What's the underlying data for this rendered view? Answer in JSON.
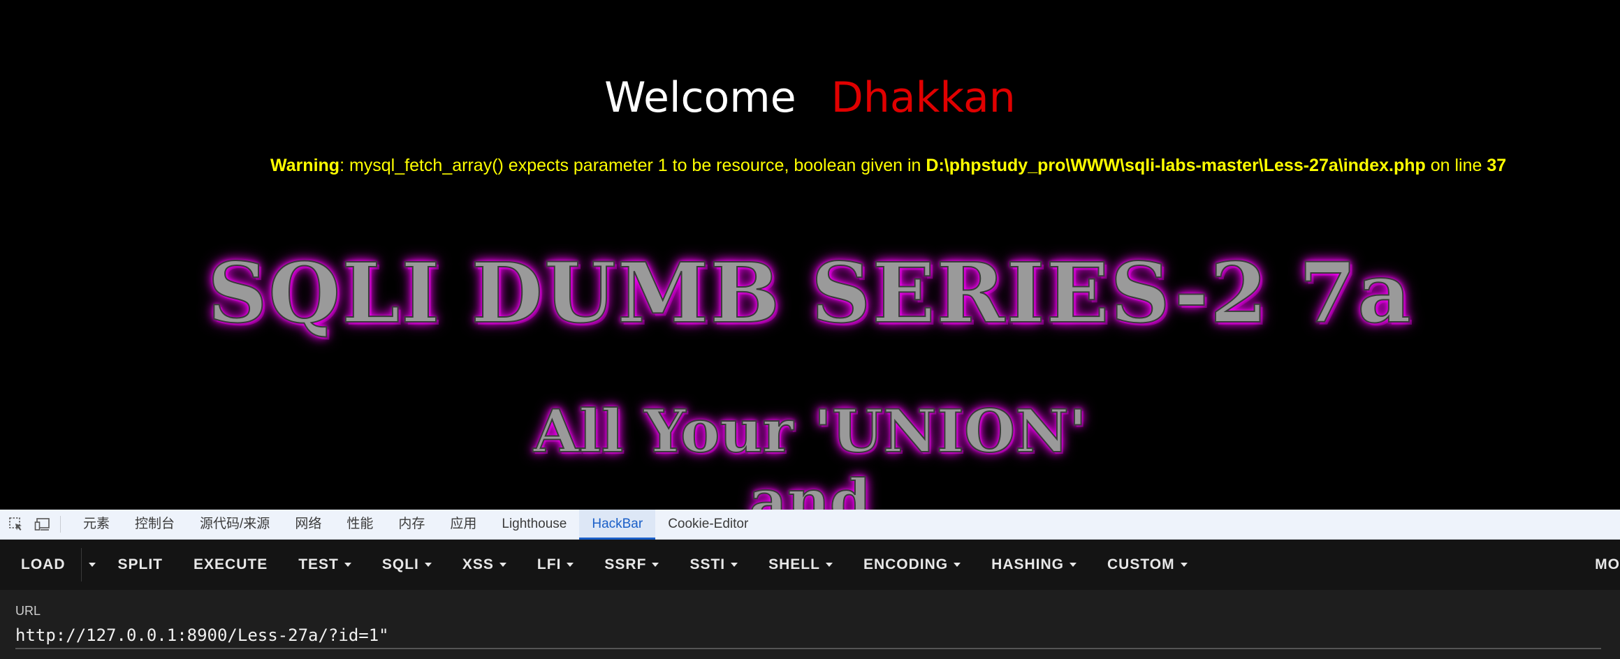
{
  "page": {
    "welcome": "Welcome",
    "name": "Dhakkan",
    "warning": {
      "label": "Warning",
      "message": ": mysql_fetch_array() expects parameter 1 to be resource, boolean given in ",
      "file": "D:\\phpstudy_pro\\WWW\\sqli-labs-master\\Less-27a\\index.php",
      "line_text": " on line ",
      "line": "37"
    },
    "banner_main": "SQLI DUMB SERIES-2 7a",
    "banner_sub": "All Your 'UNION'",
    "banner_sub2": "and"
  },
  "devtools": {
    "tabs": [
      "元素",
      "控制台",
      "源代码/来源",
      "网络",
      "性能",
      "内存",
      "应用",
      "Lighthouse",
      "HackBar",
      "Cookie-Editor"
    ],
    "active_tab": "HackBar",
    "icons": [
      "inspect-element-icon",
      "device-toolbar-icon"
    ]
  },
  "hackbar": {
    "buttons": {
      "load": "LOAD",
      "split": "SPLIT",
      "execute": "EXECUTE",
      "test": "TEST",
      "sqli": "SQLI",
      "xss": "XSS",
      "lfi": "LFI",
      "ssrf": "SSRF",
      "ssti": "SSTI",
      "shell": "SHELL",
      "encoding": "ENCODING",
      "hashing": "HASHING",
      "custom": "CUSTOM",
      "more": "MO"
    },
    "url_label": "URL",
    "url_value": "http://127.0.0.1:8900/Less-27a/?id=1\""
  },
  "colors": {
    "background": "#000000",
    "welcome": "#ffffff",
    "name": "#e00000",
    "warning": "#ffff00",
    "banner_glow": "#ff00ff",
    "active_tab": "#1a5fc8"
  }
}
